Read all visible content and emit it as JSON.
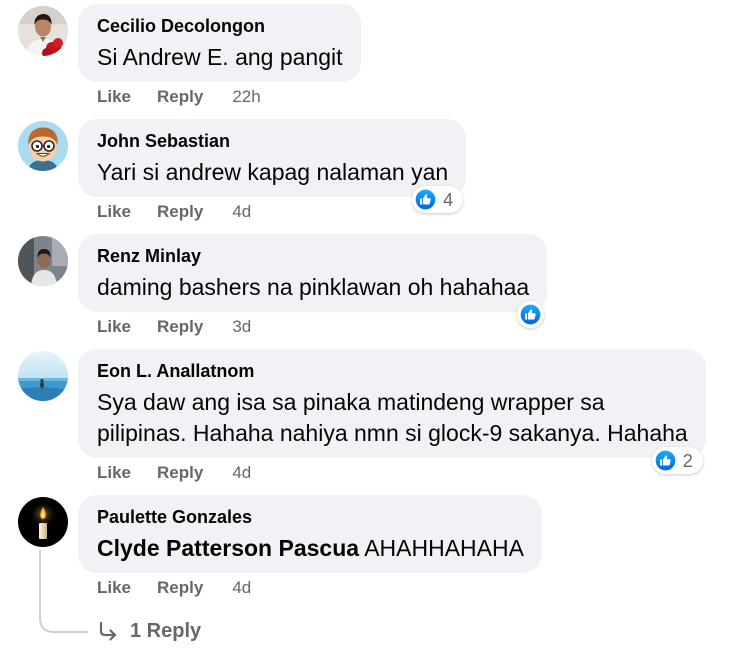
{
  "colors": {
    "page": "#ffffff",
    "bubble": "#f0f2f5",
    "text": "#050505",
    "secondary": "#65676b",
    "line": "#ccd0d5"
  },
  "labels": {
    "like": "Like",
    "reply": "Reply"
  },
  "comments": [
    {
      "author": "Cecilio Decolongon",
      "text": "Si Andrew E. ang pangit",
      "time": "22h"
    },
    {
      "author": "John Sebastian",
      "text": "Yari si andrew kapag nalaman yan",
      "time": "4d",
      "reactions": {
        "icon": "like-reaction-icon",
        "count": "4"
      }
    },
    {
      "author": "Renz Minlay",
      "text": "daming bashers na pinklawan oh hahahaa",
      "time": "3d",
      "reactions": {
        "icon": "like-reaction-icon"
      }
    },
    {
      "author": "Eon L. Anallatnom",
      "text_lines": [
        "Sya daw ang isa sa pinaka matindeng wrapper sa",
        "pilipinas. Hahaha nahiya nmn si glock-9 sakanya. Hahaha"
      ],
      "time": "4d",
      "reactions": {
        "icon": "like-reaction-icon",
        "count": "2"
      }
    },
    {
      "author": "Paulette Gonzales",
      "mention": "Clyde Patterson Pascua",
      "text": "AHAHHAHAHA",
      "time": "4d"
    }
  ],
  "replies": {
    "icon": "reply-arrow-icon",
    "label": "1 Reply"
  }
}
